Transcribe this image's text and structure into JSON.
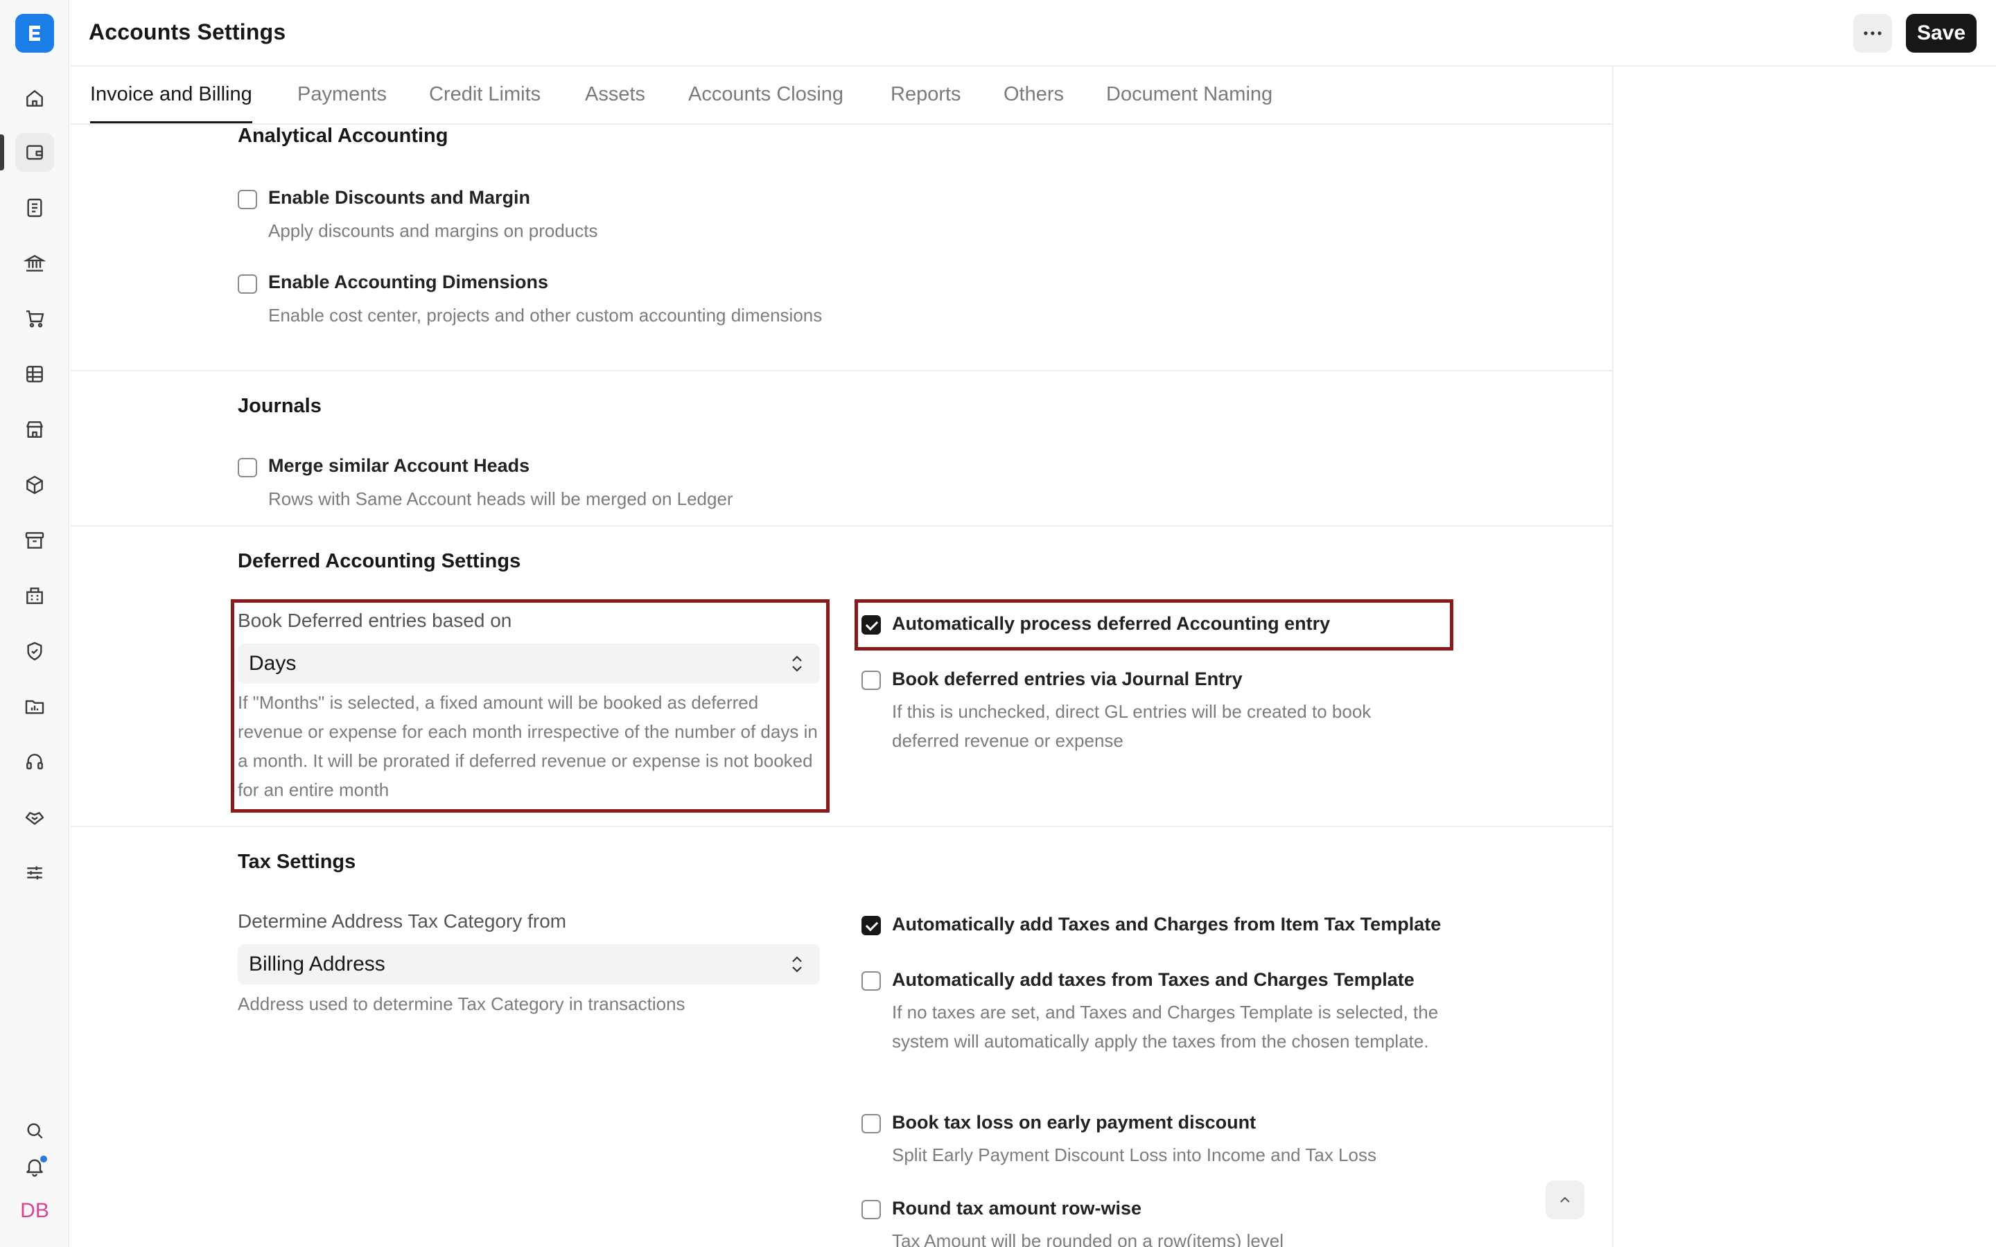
{
  "app": {
    "logo_letter": "E",
    "title": "Accounts Settings"
  },
  "header": {
    "save_label": "Save",
    "menu_icon": "more-horizontal-icon"
  },
  "tabs": [
    {
      "label": "Invoice and Billing",
      "active": true
    },
    {
      "label": "Payments"
    },
    {
      "label": "Credit Limits"
    },
    {
      "label": "Assets"
    },
    {
      "label": "Accounts Closing"
    },
    {
      "label": "Reports"
    },
    {
      "label": "Others"
    },
    {
      "label": "Document Naming"
    }
  ],
  "sidebar": {
    "items": [
      "home-icon",
      "wallet-icon",
      "document-icon",
      "bank-icon",
      "cart-icon",
      "table-icon",
      "store-icon",
      "package-icon",
      "archive-icon",
      "building-icon",
      "shield-icon",
      "folder-chart-icon",
      "headset-icon",
      "handshake-icon",
      "sliders-icon"
    ],
    "active_index": 1,
    "bottom": [
      "search-icon",
      "bell-icon"
    ],
    "avatar": "DB",
    "accent": "#1c7ee8"
  },
  "sections": {
    "analytical": {
      "title": "Analytical Accounting",
      "discounts": {
        "label": "Enable Discounts and Margin",
        "desc": "Apply discounts and margins on products",
        "checked": false
      },
      "dimensions": {
        "label": "Enable Accounting Dimensions",
        "desc": "Enable cost center, projects and other custom accounting dimensions",
        "checked": false
      }
    },
    "journals": {
      "title": "Journals",
      "merge": {
        "label": "Merge similar Account Heads",
        "desc": "Rows with Same Account heads will be merged on Ledger",
        "checked": false
      }
    },
    "deferred": {
      "title": "Deferred Accounting Settings",
      "book_based_on": {
        "label": "Book Deferred entries based on",
        "value": "Days",
        "desc": "If \"Months\" is selected, a fixed amount will be booked as deferred revenue or expense for each month irrespective of the number of days in a month. It will be prorated if deferred revenue or expense is not booked for an entire month"
      },
      "auto_process": {
        "label": "Automatically process deferred Accounting entry",
        "checked": true
      },
      "via_journal": {
        "label": "Book deferred entries via Journal Entry",
        "desc": "If this is unchecked, direct GL entries will be created to book deferred revenue or expense",
        "checked": false
      }
    },
    "tax": {
      "title": "Tax Settings",
      "address_category": {
        "label": "Determine Address Tax Category from",
        "value": "Billing Address",
        "desc": "Address used to determine Tax Category in transactions"
      },
      "auto_item_tax": {
        "label": "Automatically add Taxes and Charges from Item Tax Template",
        "checked": true
      },
      "auto_template_tax": {
        "label": "Automatically add taxes from Taxes and Charges Template",
        "desc": "If no taxes are set, and Taxes and Charges Template is selected, the system will automatically apply the taxes from the chosen template.",
        "checked": false
      },
      "tax_loss": {
        "label": "Book tax loss on early payment discount",
        "desc": "Split Early Payment Discount Loss into Income and Tax Loss",
        "checked": false
      },
      "round_row": {
        "label": "Round tax amount row-wise",
        "desc": "Tax Amount will be rounded on a row(items) level",
        "checked": false
      }
    }
  },
  "highlight_color": "#8b1a1a"
}
